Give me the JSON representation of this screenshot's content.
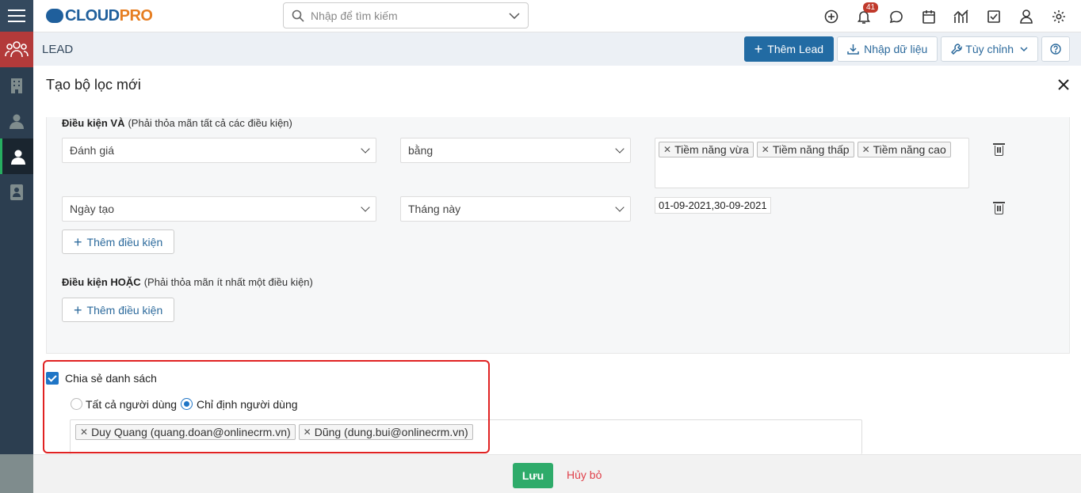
{
  "app": {
    "logo_main": "CLOUD",
    "logo_accent": "PRO"
  },
  "search": {
    "placeholder": "Nhập để tìm kiếm"
  },
  "notifications": {
    "count": "41"
  },
  "page": {
    "title": "LEAD"
  },
  "toolbar": {
    "add_label": "Thêm Lead",
    "import_label": "Nhập dữ liệu",
    "customize_label": "Tùy chỉnh"
  },
  "modal": {
    "title": "Tạo bộ lọc mới",
    "and_section": {
      "title": "Điều kiện VÀ",
      "hint": "(Phải thỏa mãn tất cả các điều kiện)"
    },
    "conditions": [
      {
        "field": "Đánh giá",
        "operator": "bằng",
        "values": [
          "Tiềm năng vừa",
          "Tiềm năng thấp",
          "Tiềm năng cao"
        ]
      },
      {
        "field": "Ngày tạo",
        "operator": "Tháng này",
        "value": "01-09-2021,30-09-2021"
      }
    ],
    "add_condition_label": "Thêm điều kiện",
    "or_section": {
      "title": "Điều kiện HOẶC",
      "hint": "(Phải thỏa mãn ít nhất một điều kiện)"
    },
    "share": {
      "label": "Chia sẻ danh sách",
      "all_users_label": "Tất cả người dùng",
      "specific_users_label": "Chỉ định người dùng",
      "users": [
        "Duy Quang (quang.doan@onlinecrm.vn)",
        "Dũng (dung.bui@onlinecrm.vn)"
      ]
    },
    "save_label": "Lưu",
    "cancel_label": "Hủy bỏ"
  }
}
